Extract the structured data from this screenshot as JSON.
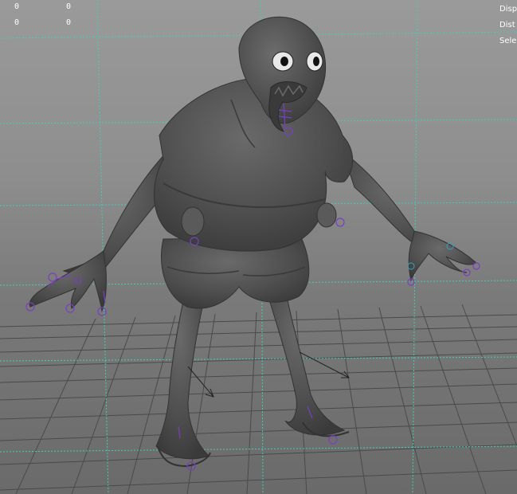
{
  "viewport": {
    "name": "3D perspective viewport"
  },
  "hud": {
    "counters": [
      {
        "col1": "0",
        "col2": "0"
      },
      {
        "col1": "0",
        "col2": "0"
      }
    ],
    "right_labels": [
      "Disp",
      "Dist",
      "Sele"
    ]
  },
  "colors": {
    "grid_line": "#3fcfb8",
    "floor_line": "#4a4a4a",
    "mesh": "#555555",
    "control": "#7a3fc0",
    "eye_white": "#e8e8e8",
    "pupil": "#111111"
  },
  "icons": {
    "grid": "viewport-grid",
    "controls": "rig-control-icon"
  }
}
